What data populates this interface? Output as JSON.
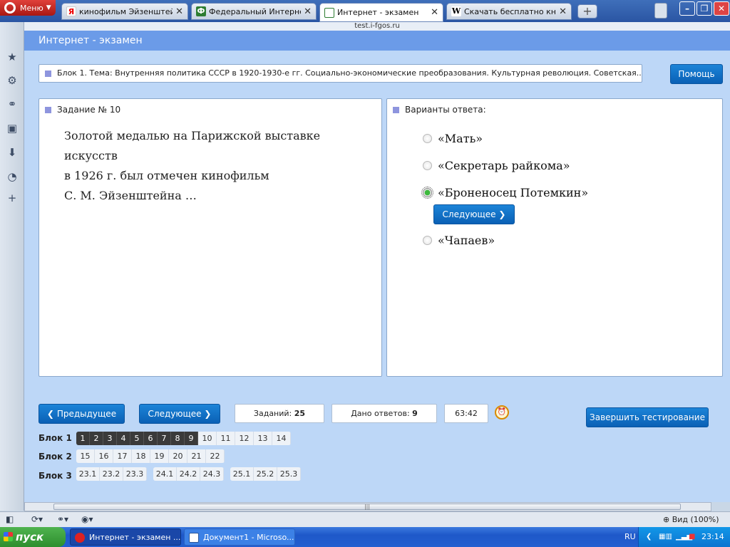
{
  "browser": {
    "menu_label": "Меню",
    "tabs": [
      {
        "title": "кинофильм Эйзенштей…",
        "icon": "yandex-icon",
        "active": false
      },
      {
        "title": "Федеральный Интерне…",
        "icon": "fi-icon",
        "active": false
      },
      {
        "title": "Интернет - экзамен",
        "icon": "page-icon",
        "active": true
      },
      {
        "title": "Скачать бесплатно кн…",
        "icon": "wikipedia-icon",
        "active": false
      }
    ],
    "url": "test.i-fgos.ru",
    "zoom_label": "Вид (100%)"
  },
  "page": {
    "header_title": "Интернет - экзамен",
    "topic": "Блок 1. Тема: Внутренняя политика СССР в 1920-1930-е гг. Социально-экономические преобразования. Культурная революция. Советская...",
    "help_label": "Помощь",
    "task_header": "Задание № 10",
    "question": [
      "Золотой медалью на Парижской выставке искусств",
      "в 1926 г. был отмечен кинофильм",
      "С. М. Эйзенштейна …"
    ],
    "answers_header": "Варианты ответа:",
    "answers": [
      {
        "text": "«Мать»",
        "selected": false
      },
      {
        "text": "«Секретарь райкома»",
        "selected": false
      },
      {
        "text": "«Броненосец Потемкин»",
        "selected": true
      },
      {
        "text": "«Чапаев»",
        "selected": false
      }
    ],
    "inline_next_label": "Следующее",
    "prev_label": "Предыдущее",
    "next_label": "Следующее",
    "tasks_label": "Заданий:",
    "tasks_count": "25",
    "answered_label": "Дано ответов:",
    "answered_count": "9",
    "timer": "63:42",
    "finish_label": "Завершить тестирование",
    "blocks": [
      {
        "label": "Блок 1",
        "groups": [
          [
            "1",
            "2",
            "3",
            "4",
            "5",
            "6",
            "7",
            "8",
            "9",
            "10",
            "11",
            "12",
            "13",
            "14"
          ]
        ],
        "done": 9
      },
      {
        "label": "Блок 2",
        "groups": [
          [
            "15",
            "16",
            "17",
            "18",
            "19",
            "20",
            "21",
            "22"
          ]
        ],
        "done": 0
      },
      {
        "label": "Блок 3",
        "groups": [
          [
            "23.1",
            "23.2",
            "23.3"
          ],
          [
            "24.1",
            "24.2",
            "24.3"
          ],
          [
            "25.1",
            "25.2",
            "25.3"
          ]
        ],
        "done": 0
      }
    ]
  },
  "taskbar": {
    "start_label": "пуск",
    "items": [
      {
        "label": "Интернет - экзамен ...",
        "active": true
      },
      {
        "label": "Документ1 - Microso...",
        "active": false
      }
    ],
    "lang": "RU",
    "clock": "23:14"
  },
  "colors": {
    "accent": "#0a60b5",
    "header": "#6b9be8",
    "page_bg": "#bdd7f7"
  }
}
